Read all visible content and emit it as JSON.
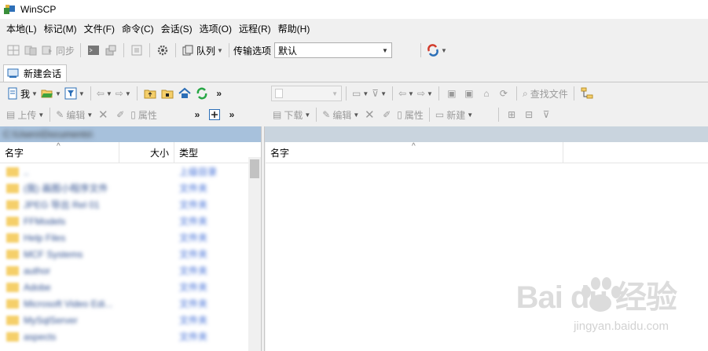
{
  "app": {
    "title": "WinSCP"
  },
  "menu": [
    "本地(L)",
    "标记(M)",
    "文件(F)",
    "命令(C)",
    "会话(S)",
    "选项(O)",
    "远程(R)",
    "帮助(H)"
  ],
  "toolbar": {
    "sync_label": "同步",
    "queue_label": "队列",
    "transfer_label": "传输选项",
    "transfer_value": "默认"
  },
  "tabs": {
    "new_session": "新建会话"
  },
  "local": {
    "drive_label": "我",
    "path": "C:\\Users\\Documents\\",
    "actions": {
      "upload": "上传",
      "edit": "编辑",
      "properties": "属性"
    },
    "columns": {
      "name": "名字",
      "size": "大小",
      "type": "类型"
    },
    "files": [
      {
        "name": "..",
        "type": "上级目录"
      },
      {
        "name": "(我) 画图小程序文件",
        "type": "文件夹"
      },
      {
        "name": "JPEG 导出 Rel 01",
        "type": "文件夹"
      },
      {
        "name": "FFModels",
        "type": "文件夹"
      },
      {
        "name": "Help Files",
        "type": "文件夹"
      },
      {
        "name": "MCF Systems",
        "type": "文件夹"
      },
      {
        "name": "author",
        "type": "文件夹"
      },
      {
        "name": "Adobe",
        "type": "文件夹"
      },
      {
        "name": "Microsoft Video Edi...",
        "type": "文件夹"
      },
      {
        "name": "MySqlServer",
        "type": "文件夹"
      },
      {
        "name": "aspects",
        "type": "文件夹"
      }
    ]
  },
  "remote": {
    "actions": {
      "download": "下载",
      "edit": "编辑",
      "properties": "属性",
      "new": "新建"
    },
    "find_files": "查找文件",
    "columns": {
      "name": "名字"
    }
  },
  "watermark": {
    "main": "Bai du 经验",
    "sub": "jingyan.baidu.com"
  },
  "colors": {
    "local_pathbar": "#a7c1dc",
    "remote_pathbar": "#c9d4de",
    "folder": "#f5cf6a",
    "refresh": "#27a745",
    "home": "#2c6fb7"
  }
}
